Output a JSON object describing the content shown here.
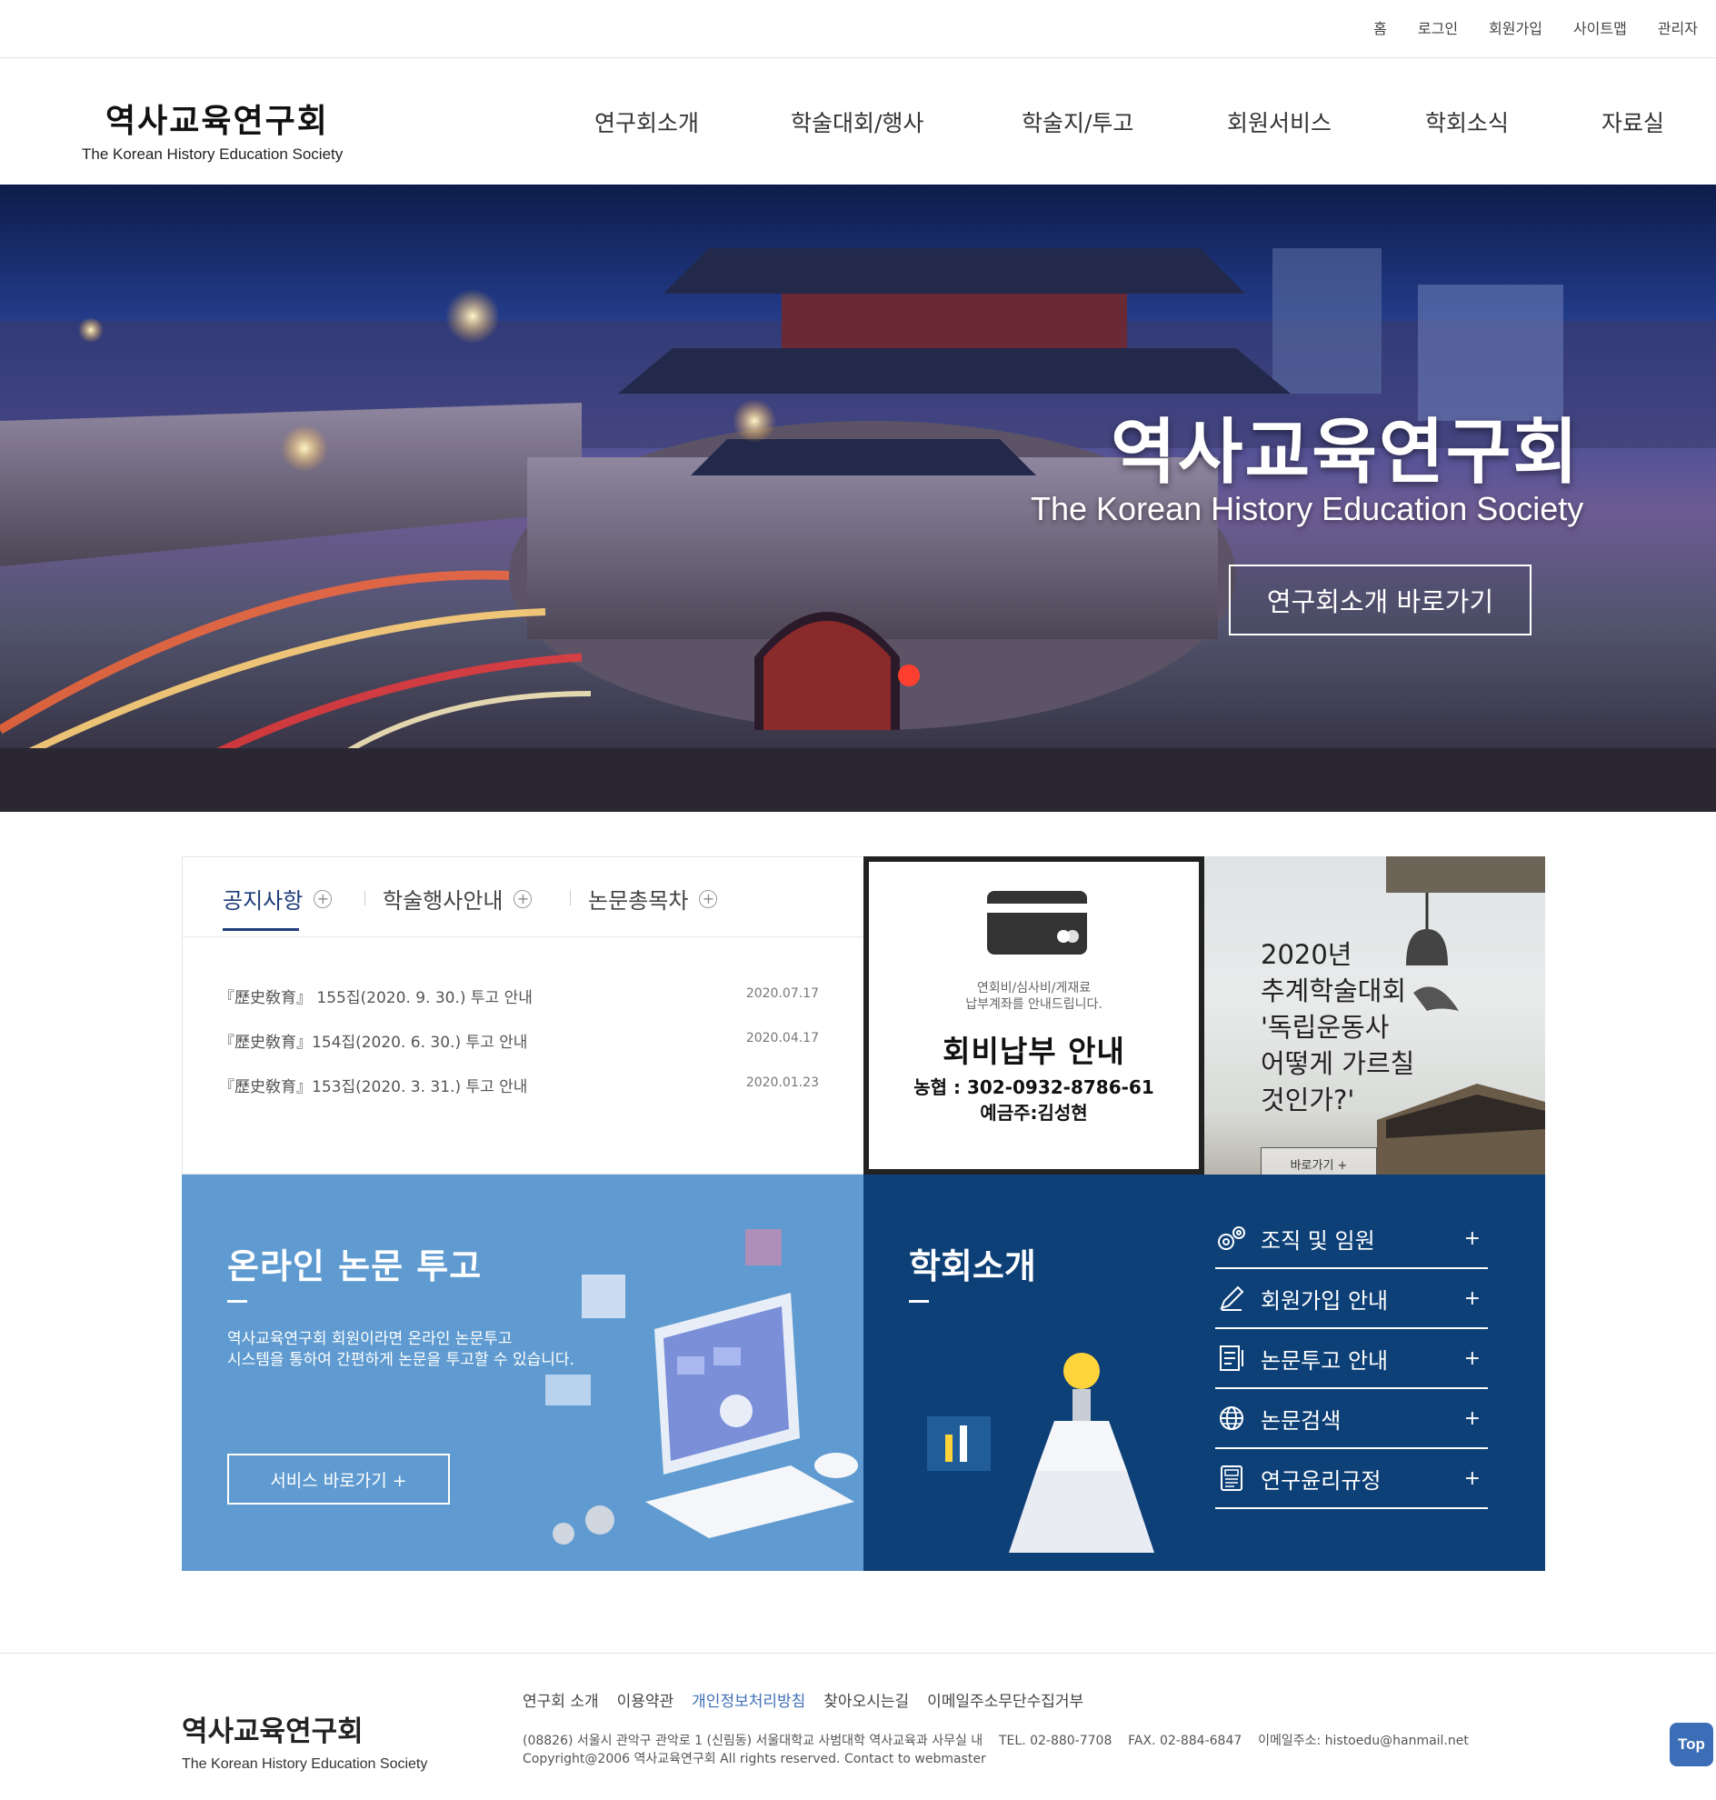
{
  "util_menu": [
    "홈",
    "로그인",
    "회원가입",
    "사이트맵",
    "관리자"
  ],
  "logo": {
    "ko": "역사교육연구회",
    "en": "The Korean History Education Society"
  },
  "nav": [
    "연구회소개",
    "학술대회/행사",
    "학술지/투고",
    "회원서비스",
    "학회소식",
    "자료실"
  ],
  "hero": {
    "title": "역사교육연구회",
    "subtitle": "The Korean History Education Society",
    "button": "연구회소개 바로가기"
  },
  "notice": {
    "tabs": [
      "공지사항",
      "학술행사안내",
      "논문총목차"
    ],
    "tab_plus": "+",
    "items": [
      {
        "title": "『歷史敎育』 155집(2020. 9. 30.) 투고 안내",
        "date": "2020.07.17"
      },
      {
        "title": "『歷史敎育』154집(2020. 6. 30.) 투고 안내",
        "date": "2020.04.17"
      },
      {
        "title": "『歷史敎育』153집(2020. 3. 31.) 투고 안내",
        "date": "2020.01.23"
      }
    ]
  },
  "fee": {
    "small1": "연회비/심사비/게재료",
    "small2": "납부계좌를 안내드립니다.",
    "title": "회비납부 안내",
    "account": "농협 : 302-0932-8786-61",
    "holder": "예금주:김성현",
    "icon": "credit-card-icon"
  },
  "conference": {
    "lines": [
      "2020년",
      "추계학술대회",
      "'독립운동사",
      "어떻게 가르칠",
      "것인가?'"
    ],
    "button": "바로가기 +"
  },
  "online": {
    "title": "온라인 논문 투고",
    "desc1": "역사교육연구회 회원이라면 온라인 논문투고",
    "desc2": "시스템을 통하여 간편하게 논문을 투고할 수 있습니다.",
    "button": "서비스 바로가기 +"
  },
  "society": {
    "title": "학회소개",
    "items": [
      {
        "label": "조직 및 임원",
        "icon": "gears-icon"
      },
      {
        "label": "회원가입 안내",
        "icon": "pencil-icon"
      },
      {
        "label": "논문투고 안내",
        "icon": "document-icon"
      },
      {
        "label": "논문검색",
        "icon": "globe-icon"
      },
      {
        "label": "연구윤리규정",
        "icon": "newspaper-icon"
      }
    ],
    "plus": "+"
  },
  "footer": {
    "logo_ko": "역사교육연구회",
    "logo_en": "The Korean History Education Society",
    "links": [
      "연구회 소개",
      "이용약관",
      "개인정보처리방침",
      "찾아오시는길",
      "이메일주소무단수집거부"
    ],
    "address": "(08826) 서울시 관악구 관악로 1 (신림동) 서울대학교 사범대학 역사교육과 사무실 내    TEL. 02-880-7708    FAX. 02-884-6847    이메일주소: histoedu@hanmail.net",
    "copyright": "Copyright@2006 역사교육연구회 All rights reserved. Contact to webmaster"
  },
  "top_button": "Top",
  "colors": {
    "accent_navy": "#1f3d7a",
    "online_blue": "#5f9bd0",
    "society_navy": "#0d4077",
    "top_blue": "#3b6eb6"
  }
}
